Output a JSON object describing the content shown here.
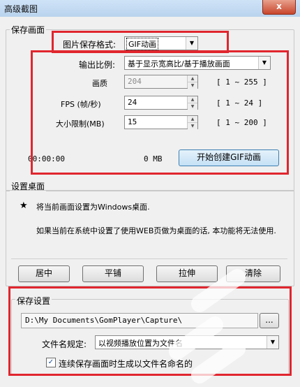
{
  "window": {
    "title": "高级截图",
    "close_label": "x"
  },
  "save_screen": {
    "legend": "保存画面",
    "format_label": "图片保存格式:",
    "format_value": "GIF动画",
    "output_ratio_label": "输出比例:",
    "output_ratio_value": "基于显示宽高比/基于播放画面",
    "quality_label": "画质",
    "quality_value": "204",
    "quality_range": "[ 1 ~ 255 ]",
    "fps_label": "FPS (帧/秒)",
    "fps_value": "24",
    "fps_range": "[ 1 ~ 24 ]",
    "size_label": "大小限制(MB)",
    "size_value": "15",
    "size_range": "[ 1 ~ 200 ]",
    "time_value": "00:00:00",
    "size_status": "0 MB",
    "create_button": "开始创建GIF动画"
  },
  "desktop": {
    "legend": "设置桌面",
    "star": "★",
    "set_text": "将当前画面设置为Windows桌面.",
    "warning_text": "如果当前在系统中设置了使用WEB页做为桌面的话, 本功能将无法使用.",
    "buttons": [
      "居中",
      "平铺",
      "拉伸",
      "清除"
    ]
  },
  "save_settings": {
    "legend": "保存设置",
    "path": "D:\\My Documents\\GomPlayer\\Capture\\",
    "browse_label": "...",
    "filename_label": "文件名规定:",
    "filename_value": "以视频播放位置为文件名",
    "continuous_label": "连续保存画面时生成以文件名命名的",
    "continuous_checked": "✓"
  }
}
